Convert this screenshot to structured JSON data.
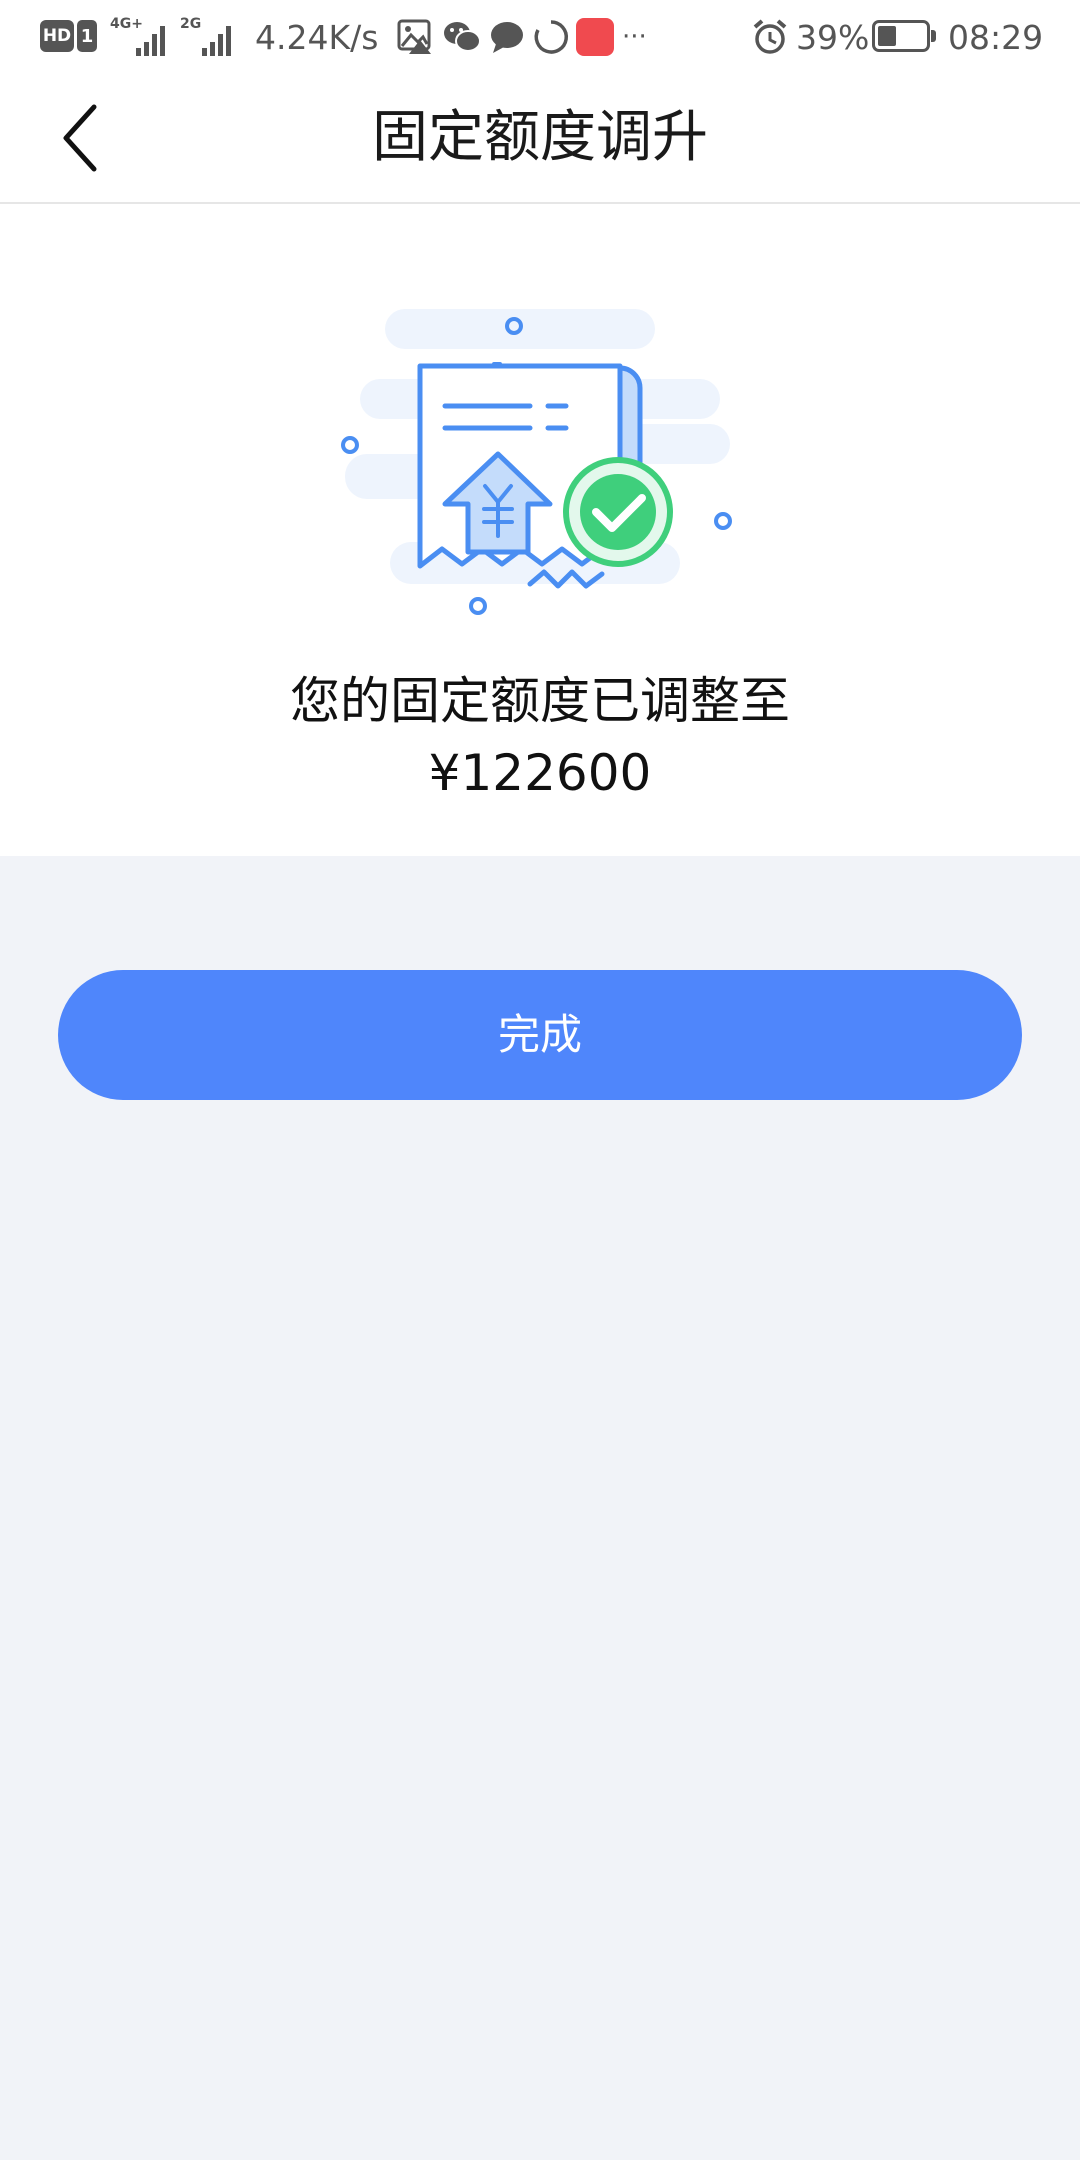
{
  "status_bar": {
    "hd_label": "HD",
    "sim_label": "1",
    "network_1": "4G+",
    "network_2": "2G",
    "speed": "4.24K/s",
    "more_indicator": "···",
    "battery_percent": "39%",
    "battery_level": 0.39,
    "time": "08:29",
    "icons": [
      "hd-icon",
      "signal-icon",
      "gallery-icon",
      "wechat-icon",
      "message-icon",
      "sync-icon",
      "huawei-app-icon",
      "alarm-icon",
      "battery-icon"
    ]
  },
  "nav": {
    "title": "固定额度调升",
    "back_icon": "chevron-left-icon"
  },
  "result": {
    "message": "您的固定额度已调整至",
    "amount": "¥122600",
    "illustration": "receipt-success-illustration"
  },
  "actions": {
    "done_label": "完成"
  },
  "colors": {
    "accent": "#4f86fb",
    "success": "#3fcf7c",
    "background": "#f1f3f8",
    "card": "#ffffff"
  }
}
